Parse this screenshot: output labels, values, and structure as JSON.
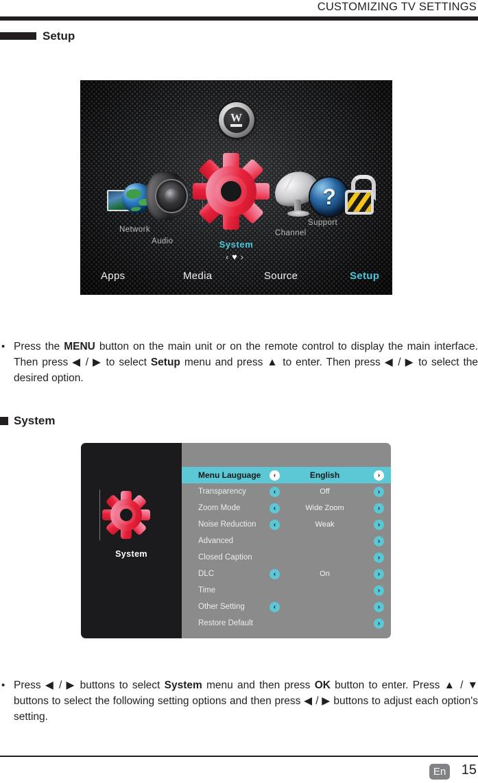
{
  "header": {
    "running_title": "CUSTOMIZING TV SETTINGS"
  },
  "sections": {
    "setup": {
      "title": "Setup"
    },
    "system": {
      "title": "System"
    }
  },
  "tv_main_menu": {
    "logo": "westinghouse-w-crown-logo",
    "logo_mark": "W",
    "icons": [
      {
        "name": "network-icon",
        "label": "Network"
      },
      {
        "name": "audio-speaker-icon",
        "label": "Audio"
      },
      {
        "name": "system-gear-icon",
        "label": "System"
      },
      {
        "name": "channel-satellite-dish-icon",
        "label": "Channel"
      },
      {
        "name": "support-globe-question-icon",
        "label": "Support"
      },
      {
        "name": "lock-padlock-icon",
        "label": ""
      }
    ],
    "selected_label": "System",
    "nav_hint": {
      "left": "‹",
      "heart": "♥",
      "right": "›"
    },
    "bottom_nav": [
      {
        "label": "Apps",
        "active": false
      },
      {
        "label": "Media",
        "active": false
      },
      {
        "label": "Source",
        "active": false
      },
      {
        "label": "Setup",
        "active": true
      }
    ],
    "support_question_mark": "?",
    "accent_color": "#49c8e0"
  },
  "paragraphs": {
    "setup": {
      "bullet": "•",
      "part1": "Press the ",
      "bold1": "MENU",
      "part2": " button on the main unit or on the remote control to display the main interface. Then press ",
      "arrows1": "◀ / ▶",
      "part3": " to select ",
      "bold2": "Setup",
      "part4": " menu and press ",
      "arrows2": "▲",
      "part5": " to enter. Then press ",
      "arrows3": "◀ / ▶",
      "part6": " to select the desired option."
    },
    "system": {
      "bullet": "•",
      "part1": "Press ",
      "arrows1": "◀ / ▶",
      "part2": " buttons to select ",
      "bold1": "System",
      "part3": " menu and then press ",
      "bold2": "OK",
      "part4": " button to enter. Press ",
      "arrows2": "▲ / ▼",
      "part5": " buttons to select the following setting options and then press ",
      "arrows3": "◀ / ▶",
      "part6": " buttons to adjust each option's setting."
    }
  },
  "osd_system_menu": {
    "sidebar": {
      "icon": "system-gear-icon",
      "label": "System"
    },
    "left_arrow_glyph": "‹",
    "right_arrow_glyph": "›",
    "highlight_color": "#5cc8d6",
    "rows": [
      {
        "label": "Menu Lauguage",
        "value": "English",
        "left_arrow": true,
        "right_arrow": true,
        "selected": true
      },
      {
        "label": "Transparency",
        "value": "Off",
        "left_arrow": true,
        "right_arrow": true,
        "selected": false
      },
      {
        "label": "Zoom Mode",
        "value": "Wide Zoom",
        "left_arrow": true,
        "right_arrow": true,
        "selected": false
      },
      {
        "label": "Noise Reduction",
        "value": "Weak",
        "left_arrow": true,
        "right_arrow": true,
        "selected": false
      },
      {
        "label": "Advanced",
        "value": "",
        "left_arrow": false,
        "right_arrow": true,
        "selected": false
      },
      {
        "label": "Closed Caption",
        "value": "",
        "left_arrow": false,
        "right_arrow": true,
        "selected": false
      },
      {
        "label": "DLC",
        "value": "On",
        "left_arrow": true,
        "right_arrow": true,
        "selected": false
      },
      {
        "label": "Time",
        "value": "",
        "left_arrow": false,
        "right_arrow": true,
        "selected": false
      },
      {
        "label": "Other Setting",
        "value": "",
        "left_arrow": true,
        "right_arrow": true,
        "selected": false
      },
      {
        "label": "Restore Default",
        "value": "",
        "left_arrow": false,
        "right_arrow": true,
        "selected": false
      }
    ]
  },
  "footer": {
    "language_badge": "En",
    "page_number": "15"
  }
}
